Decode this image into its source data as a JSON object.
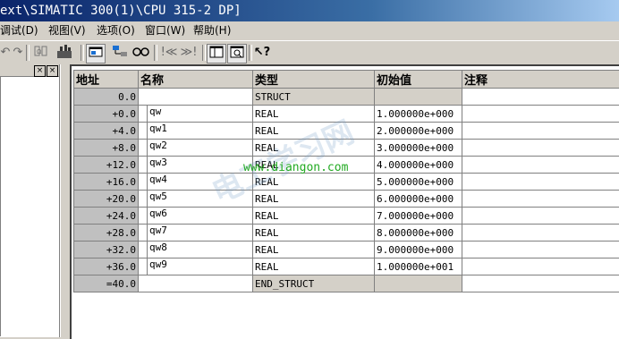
{
  "title": "ext\\SIMATIC 300(1)\\CPU 315-2 DP]",
  "menu": [
    "调试(D)",
    "视图(V)",
    "选项(O)",
    "窗口(W)",
    "帮助(H)"
  ],
  "toolbar_icons": [
    "undo-icon",
    "redo-icon",
    "monitor-icon",
    "download-icon",
    "window-icon",
    "network-icon",
    "glasses-icon",
    "breakpoint-prev-icon",
    "breakpoint-next-icon",
    "layout-icon",
    "zoom-icon",
    "help-pointer-icon"
  ],
  "table": {
    "headers": {
      "addr": "地址",
      "name": "名称",
      "type": "类型",
      "init": "初始值",
      "comment": "注释"
    },
    "rows": [
      {
        "addr": "0.0",
        "name": "",
        "type": "STRUCT",
        "init": "",
        "comment": "",
        "kind": "struct"
      },
      {
        "addr": "+0.0",
        "name": "qw",
        "type": "REAL",
        "init": "1.000000e+000",
        "comment": ""
      },
      {
        "addr": "+4.0",
        "name": "qw1",
        "type": "REAL",
        "init": "2.000000e+000",
        "comment": ""
      },
      {
        "addr": "+8.0",
        "name": "qw2",
        "type": "REAL",
        "init": "3.000000e+000",
        "comment": ""
      },
      {
        "addr": "+12.0",
        "name": "qw3",
        "type": "REAL",
        "init": "4.000000e+000",
        "comment": ""
      },
      {
        "addr": "+16.0",
        "name": "qw4",
        "type": "REAL",
        "init": "5.000000e+000",
        "comment": ""
      },
      {
        "addr": "+20.0",
        "name": "qw5",
        "type": "REAL",
        "init": "6.000000e+000",
        "comment": ""
      },
      {
        "addr": "+24.0",
        "name": "qw6",
        "type": "REAL",
        "init": "7.000000e+000",
        "comment": ""
      },
      {
        "addr": "+28.0",
        "name": "qw7",
        "type": "REAL",
        "init": "8.000000e+000",
        "comment": ""
      },
      {
        "addr": "+32.0",
        "name": "qw8",
        "type": "REAL",
        "init": "9.000000e+000",
        "comment": ""
      },
      {
        "addr": "+36.0",
        "name": "qw9",
        "type": "REAL",
        "init": "1.000000e+001",
        "comment": ""
      },
      {
        "addr": "=40.0",
        "name": "",
        "type": "END_STRUCT",
        "init": "",
        "comment": "",
        "kind": "struct"
      }
    ]
  },
  "watermark": "www.diangon.com",
  "colors": {
    "titlebar_start": "#0a246a",
    "titlebar_end": "#a6caf0",
    "watermark": "#22aa22",
    "grid_header": "#d4d0c8"
  }
}
